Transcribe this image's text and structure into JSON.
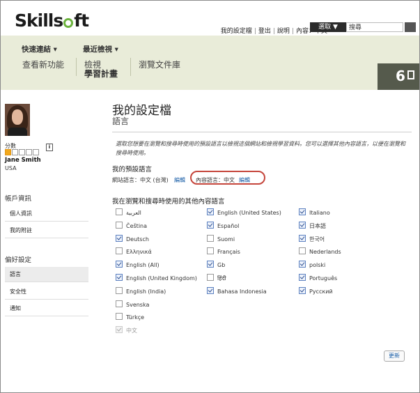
{
  "brand": {
    "logo_text_1": "Skills",
    "logo_text_2": "ft"
  },
  "header": {
    "links": [
      "我的設定檔",
      "登出",
      "說明",
      "內容：中文"
    ],
    "select_label": "選取 ▼",
    "search_value": "搜尋"
  },
  "nav": {
    "quick_links": "快速連結 ▾",
    "recently_viewed": "最近檢視 ▾",
    "whats_new": "查看新功能",
    "view_line1": "檢視",
    "view_line2": "學習計畫",
    "browse_library": "瀏覽文件庫",
    "badge_count": "6"
  },
  "profile": {
    "score_label": "分數",
    "info_icon": "i",
    "score_filled": 1,
    "score_total": 5,
    "name": "Jane Smith",
    "country": "USA"
  },
  "sidebar": {
    "account_head": "帳戶資訊",
    "account_items": [
      "個人資訊",
      "我的附註"
    ],
    "prefs_head": "偏好設定",
    "pref_items": [
      "語言",
      "安全性",
      "通知"
    ],
    "active_item": "語言"
  },
  "main": {
    "title": "我的設定檔",
    "subtitle": "語言",
    "description": "選取您想要在瀏覽和搜尋時使用的預設語言以檢視這個網站和檢視學習資料。您可以選擇其他內容語言，以便在瀏覽和搜尋時使用。",
    "default_lang_label": "我的預設語言",
    "site_lang": "網站語言：中文 (台灣)",
    "site_edit": "編輯",
    "content_lang": "內容語言：中文",
    "content_edit": "編輯",
    "other_lang_label": "我在瀏覽和搜尋時使用的其他內容語言",
    "update_button": "更新"
  },
  "languages": {
    "col1": [
      {
        "label": "العربية",
        "checked": false
      },
      {
        "label": "Čeština",
        "checked": false
      },
      {
        "label": "Deutsch",
        "checked": true
      },
      {
        "label": "Ελληνικά",
        "checked": false
      },
      {
        "label": "English (All)",
        "checked": true
      },
      {
        "label": "English (United Kingdom)",
        "checked": true
      },
      {
        "label": "English (India)",
        "checked": false
      },
      {
        "label": "Svenska",
        "checked": false
      },
      {
        "label": "Türkçe",
        "checked": false
      },
      {
        "label": "中文",
        "checked": true,
        "disabled": true
      }
    ],
    "col2": [
      {
        "label": "English (United States)",
        "checked": true
      },
      {
        "label": "Español",
        "checked": true
      },
      {
        "label": "Suomi",
        "checked": false
      },
      {
        "label": "Français",
        "checked": false
      },
      {
        "label": "Gb",
        "checked": true
      },
      {
        "label": "हिंदी",
        "checked": false
      },
      {
        "label": "Bahasa Indonesia",
        "checked": true
      }
    ],
    "col3": [
      {
        "label": "Italiano",
        "checked": true
      },
      {
        "label": "日本語",
        "checked": true
      },
      {
        "label": "한국어",
        "checked": true
      },
      {
        "label": "Nederlands",
        "checked": false
      },
      {
        "label": "polski",
        "checked": true
      },
      {
        "label": "Português",
        "checked": true
      },
      {
        "label": "Русский",
        "checked": true
      }
    ]
  }
}
